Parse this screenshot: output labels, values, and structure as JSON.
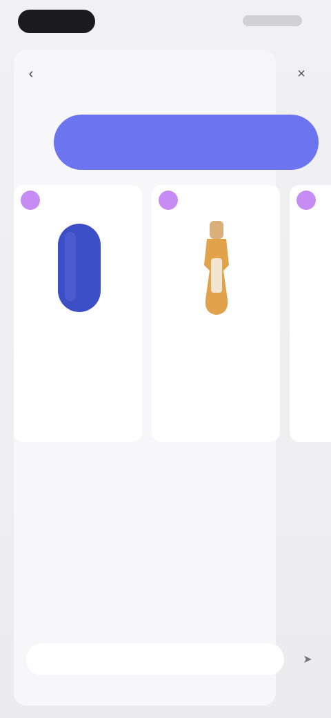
{
  "header": {
    "title": "",
    "subtitle": ""
  },
  "cta": {
    "label": ""
  },
  "products": [
    {
      "badge": "",
      "brand": "",
      "name": "",
      "color": "#3d4fc7"
    },
    {
      "badge": "",
      "brand": "",
      "name": "",
      "color": "#e0a24a"
    },
    {
      "badge": "",
      "brand": "",
      "name": "",
      "color": "#cfcfd6"
    }
  ],
  "description": "",
  "input": {
    "placeholder": ""
  },
  "icons": {
    "back": "back-arrow-icon",
    "close": "close-icon",
    "send": "send-icon"
  },
  "colors": {
    "accent": "#6d74ef",
    "badge": "#c78cf3",
    "link": "#7a82f0"
  }
}
